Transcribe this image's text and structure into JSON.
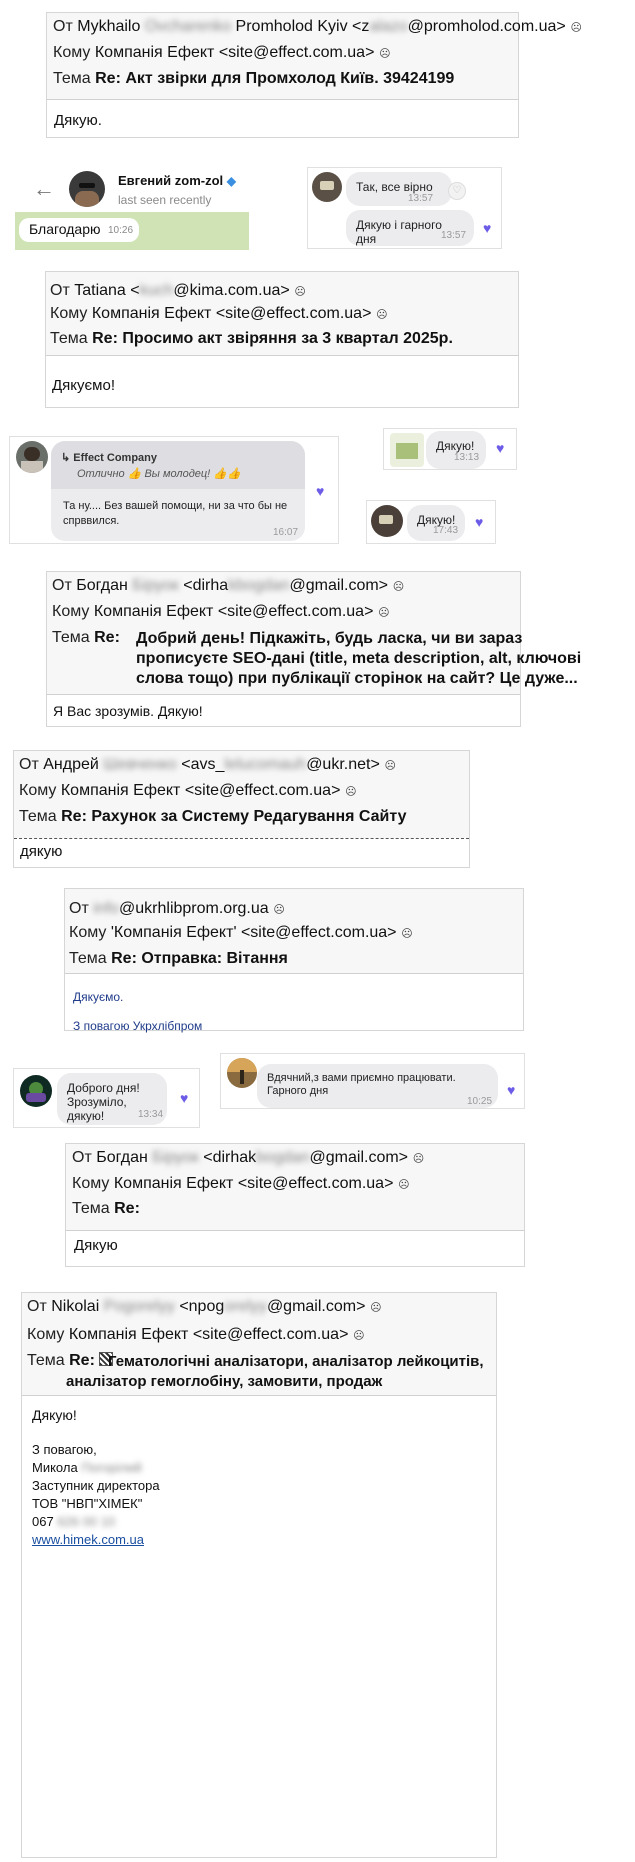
{
  "labels": {
    "from": "От",
    "to": "Кому",
    "subject": "Тема"
  },
  "emails": [
    {
      "from_name": "Mykhailo",
      "from_blur": "Ovcharenko",
      "from_org": "Promholod Kyiv <z",
      "from_blur2": "alazo",
      "from_domain": "@promholod.com.ua>",
      "to": "Компанія Ефект <site@effect.com.ua>",
      "subject_prefix": "Re:",
      "subject": "Акт звірки для Промхолод Київ. 39424199",
      "body": "Дякую."
    },
    {
      "from_name": "Tatiana <",
      "from_blur": "kuch",
      "from_domain": "@kima.com.ua>",
      "to": "Компанія Ефект <site@effect.com.ua>",
      "subject_prefix": "Re:",
      "subject": "Просимо акт звіряння за 3 квартал 2025р.",
      "body": "Дякуємо!"
    },
    {
      "from_name": "Богдан",
      "from_blur": "Біруок",
      "from_mid": "<dirha",
      "from_blur2": "kbogdan",
      "from_domain": "@gmail.com>",
      "to": "Компанія Ефект <site@effect.com.ua>",
      "subject_prefix": "Re:",
      "subject_lines": [
        "Добрий день! Підкажіть, будь ласка, чи ви зараз",
        "прописуєте SEO-дані (title, meta description, alt, ключові",
        "слова тощо) при публікації сторінок на сайт? Це дуже..."
      ],
      "body": "Я Вас зрозумів. Дякую!"
    },
    {
      "from_name": "Андрей",
      "from_blur": "Шевченко",
      "from_mid": "<avs_",
      "from_blur2": "lelucomauh",
      "from_domain": "@ukr.net>",
      "to": "Компанія Ефект <site@effect.com.ua>",
      "subject_prefix": "Re:",
      "subject": "Рахунок за Систему Редагування Сайту",
      "body": "дякую"
    },
    {
      "from_blur": "info",
      "from_domain": "@ukrhlibprom.org.ua",
      "to": "'Компанія Ефект' <site@effect.com.ua>",
      "subject_prefix": "Re:",
      "subject": "Отправка: Вітання",
      "body": "Дякуємо.",
      "signature": "З повагою Укрхлібпром"
    },
    {
      "from_name": "Богдан",
      "from_blur": "Біруок",
      "from_mid": "<dirhak",
      "from_blur2": "bogdan",
      "from_domain": "@gmail.com>",
      "to": "Компанія Ефект <site@effect.com.ua>",
      "subject_prefix": "Re:",
      "body": "Дякую"
    },
    {
      "from_name": "Nikolai",
      "from_blur": "Pogorelyy",
      "from_mid": "<npog",
      "from_blur2": "orelyy",
      "from_domain": "@gmail.com>",
      "to": "Компанія Ефект <site@effect.com.ua>",
      "subject_prefix": "Re:",
      "subject_lines": [
        "Гематологічні аналізатори, аналізатор лейкоцитів,",
        "аналізатор гемоглобіну, замовити, продаж"
      ],
      "body": "Дякую!",
      "sig_lines": [
        "З повагою,",
        "Микола",
        "Заступник директора",
        "ТОВ \"НВП\"ХІМЕК\"",
        "067"
      ],
      "sig_blur_name": "Погорілий",
      "sig_blur_phone": "626 00 10",
      "link": "www.himek.com.ua"
    }
  ],
  "telegram": {
    "name": "Евгений zom-zol",
    "status": "last seen recently",
    "message": "Благодарю",
    "time": "10:26"
  },
  "chats": [
    {
      "lines": [
        "Так, все вірно"
      ],
      "time": "13:57"
    },
    {
      "lines": [
        "Дякую і гарного дня"
      ],
      "time": "13:57"
    },
    {
      "reply_name": "Effect Company",
      "reply_text": "Отлично 👍 Вы молодец! 👍👍",
      "lines": [
        "Та ну.... Без вашей помощи, ни за что бы не",
        "спрввился."
      ],
      "time": "16:07"
    },
    {
      "lines": [
        "Дякую!"
      ],
      "time": "13:13"
    },
    {
      "lines": [
        "Дякую!"
      ],
      "time": "17:43"
    },
    {
      "lines": [
        "Доброго дня!",
        "Зрозуміло, дякую!"
      ],
      "time": "13:34"
    },
    {
      "lines": [
        "Вдячний,з вами приємно працювати.",
        "Гарного дня"
      ],
      "time": "10:25"
    }
  ],
  "colors": {
    "heart": "#6c5ce7",
    "link": "#1a4fa0",
    "blue_text": "#1f3b8a",
    "telegram_bg": "#cfe3b4"
  }
}
